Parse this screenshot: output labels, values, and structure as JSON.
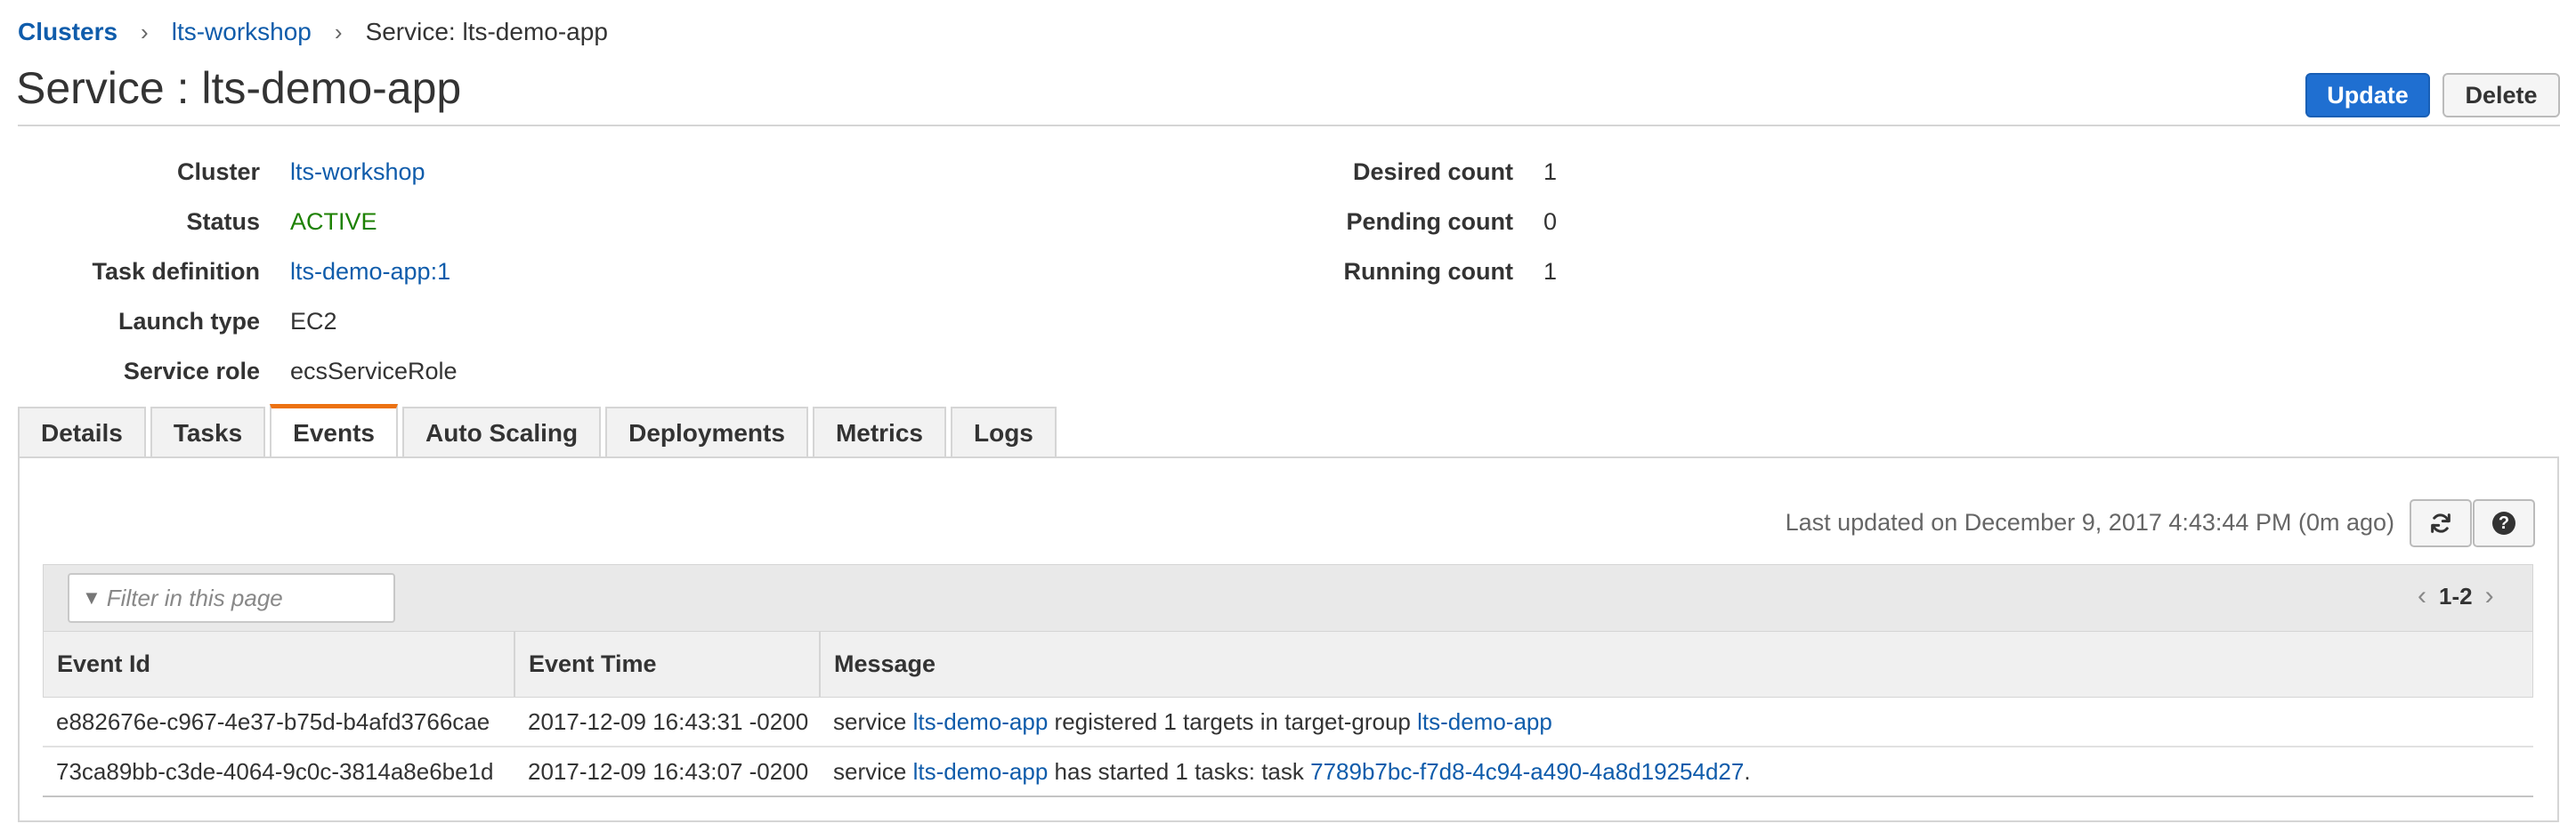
{
  "breadcrumb": {
    "root": "Clusters",
    "cluster": "lts-workshop",
    "current": "Service: lts-demo-app"
  },
  "page": {
    "title": "Service : lts-demo-app",
    "update_label": "Update",
    "delete_label": "Delete"
  },
  "summary_left": [
    {
      "key": "Cluster",
      "value": "lts-workshop"
    },
    {
      "key": "Status",
      "value": "ACTIVE"
    },
    {
      "key": "Task definition",
      "value": "lts-demo-app:1"
    },
    {
      "key": "Launch type",
      "value": "EC2"
    },
    {
      "key": "Service role",
      "value": "ecsServiceRole"
    }
  ],
  "summary_right": [
    {
      "key": "Desired count",
      "value": "1"
    },
    {
      "key": "Pending count",
      "value": "0"
    },
    {
      "key": "Running count",
      "value": "1"
    }
  ],
  "tabs": [
    "Details",
    "Tasks",
    "Events",
    "Auto Scaling",
    "Deployments",
    "Metrics",
    "Logs"
  ],
  "active_tab": "Events",
  "events": {
    "last_updated": "Last updated on December 9, 2017 4:43:44 PM (0m ago)",
    "filter_placeholder": "Filter in this page",
    "pager_range": "1-2",
    "columns": [
      "Event Id",
      "Event Time",
      "Message"
    ],
    "rows": [
      {
        "id": "e882676e-c967-4e37-b75d-b4afd3766cae",
        "time": "2017-12-09 16:43:31 -0200",
        "msg_prefix": "service ",
        "msg_link1": "lts-demo-app",
        "msg_middle": " registered 1 targets in target-group ",
        "msg_link2": "lts-demo-app",
        "msg_suffix": ""
      },
      {
        "id": "73ca89bb-c3de-4064-9c0c-3814a8e6be1d",
        "time": "2017-12-09 16:43:07 -0200",
        "msg_prefix": "service ",
        "msg_link1": "lts-demo-app",
        "msg_middle": " has started 1 tasks: task ",
        "msg_link2": "7789b7bc-f7d8-4c94-a490-4a8d19254d27",
        "msg_suffix": "."
      }
    ]
  },
  "icons": {
    "refresh": "refresh-icon",
    "help": "help-icon",
    "filter": "filter-icon"
  },
  "colors": {
    "link": "#0f5cab",
    "active_status": "#1d8102",
    "primary_button": "#1f6fd1",
    "active_tab_accent": "#ec7211"
  }
}
